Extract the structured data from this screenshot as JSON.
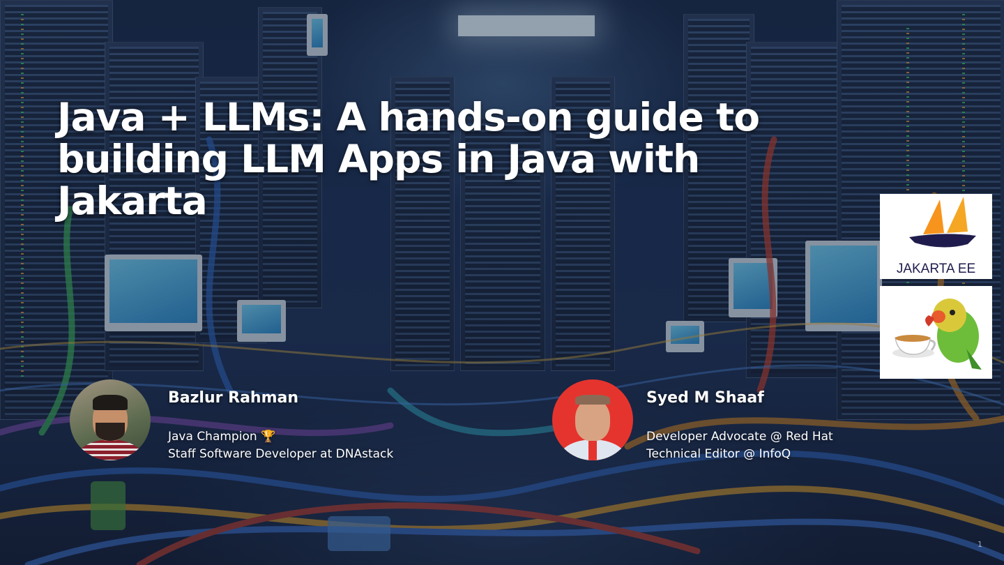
{
  "slide": {
    "title": "Java + LLMs: A hands-on guide to building LLM Apps in Java with Jakarta",
    "page_number": "1"
  },
  "speakers": [
    {
      "name": "Bazlur Rahman",
      "role_line1": "Java Champion 🏆",
      "role_line2": "Staff Software Developer at DNAstack"
    },
    {
      "name": "Syed M Shaaf",
      "role_line1": "Developer Advocate @ Red Hat",
      "role_line2": "Technical Editor @ InfoQ"
    }
  ],
  "logos": {
    "jakarta_label": "JAKARTA EE",
    "jakarta_colors": [
      "#f5a623",
      "#f7941d",
      "#1f1c4d"
    ],
    "parrot_icon": "parrot-with-teacup"
  }
}
